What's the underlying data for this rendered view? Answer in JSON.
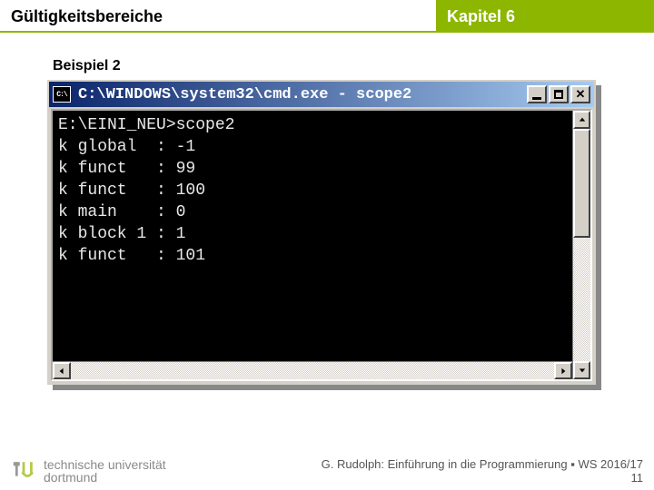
{
  "header": {
    "left": "Gültigkeitsbereiche",
    "right": "Kapitel 6"
  },
  "subtitle": "Beispiel 2",
  "cmd": {
    "sysicon_label": "C:\\",
    "title": "C:\\WINDOWS\\system32\\cmd.exe - scope2",
    "output": "E:\\EINI_NEU>scope2\nk global  : -1\nk funct   : 99\nk funct   : 100\nk main    : 0\nk block 1 : 1\nk funct   : 101"
  },
  "footer": {
    "uni_line1": "technische universität",
    "uni_line2": "dortmund",
    "credit": "G. Rudolph: Einführung in die Programmierung ▪ WS 2016/17",
    "page": "11"
  }
}
